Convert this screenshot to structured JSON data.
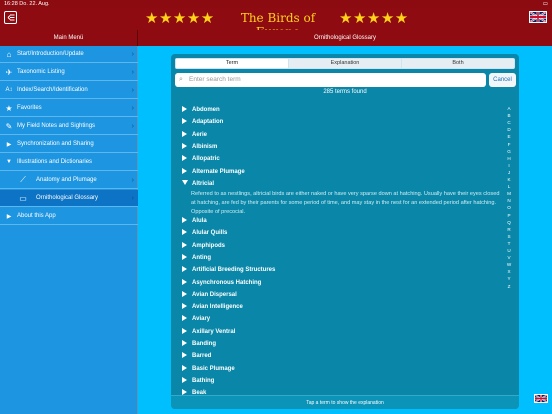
{
  "status_bar": {
    "time": "16:28",
    "date": "Do. 22. Aug."
  },
  "app": {
    "title": "The Birds of Europe",
    "stars": "★★★★★"
  },
  "sidebar": {
    "header": "Main Menü",
    "items": [
      {
        "label": "Start/Introduction/Update",
        "icon": "home-icon",
        "glyph": "⌂"
      },
      {
        "label": "Taxonomic Listing",
        "icon": "bird-icon",
        "glyph": "✈"
      },
      {
        "label": "Index/Search/Identification",
        "icon": "az-index-icon",
        "glyph": "A↕"
      },
      {
        "label": "Favorites",
        "icon": "star-icon",
        "glyph": "★"
      },
      {
        "label": "My Field Notes and Sightings",
        "icon": "notes-icon",
        "glyph": "✎"
      },
      {
        "label": "Synchronization and Sharing",
        "icon": "triangle-right-icon",
        "glyph": "▶"
      },
      {
        "label": "Illustrations and Dictionaries",
        "icon": "triangle-down-icon",
        "glyph": "▼"
      },
      {
        "label": "Anatomy and Plumage",
        "icon": "feather-icon",
        "glyph": "⟋"
      },
      {
        "label": "Ornithological Glossary",
        "icon": "book-icon",
        "glyph": "▭"
      },
      {
        "label": "About this App",
        "icon": "triangle-right-icon",
        "glyph": "▶"
      }
    ]
  },
  "main": {
    "header": "Ornithological Glossary",
    "tabs": [
      {
        "label": "Term",
        "active": true
      },
      {
        "label": "Explanation",
        "active": false
      },
      {
        "label": "Both",
        "active": false
      }
    ],
    "search": {
      "placeholder": "Enter search term",
      "cancel": "Cancel"
    },
    "count": "285 terms found",
    "terms": [
      "Abdomen",
      "Adaptation",
      "Aerie",
      "Albinism",
      "Allopatric",
      "Alternate Plumage",
      "Altricial",
      "Alula",
      "Alular Quills",
      "Amphipods",
      "Anting",
      "Artificial Breeding Structures",
      "Asynchronous Hatching",
      "Avian Dispersal",
      "Avian Intelligence",
      "Aviary",
      "Axillary Ventral",
      "Banding",
      "Barred",
      "Basic Plumage",
      "Bathing",
      "Beak"
    ],
    "expanded_term": "Altricial",
    "explanation": "Referred to as nestlings, altricial birds are either naked or have very sparse down at hatching. Usually have their eyes closed at hatching, are fed by their parents for some period of time, and may stay in the nest for an extended period after hatching. Opposite of precocial.",
    "alphabet": [
      "A",
      "B",
      "C",
      "D",
      "E",
      "F",
      "G",
      "H",
      "I",
      "J",
      "K",
      "L",
      "M",
      "N",
      "O",
      "P",
      "Q",
      "R",
      "S",
      "T",
      "U",
      "V",
      "W",
      "X",
      "Y",
      "Z"
    ],
    "footer": "Tap a term to show the explanation"
  },
  "colors": {
    "titlebar": "#8e0b12",
    "background": "#00bfff",
    "sidebar": "#1e95e0",
    "panel": "#0a87a8",
    "stars": "#ffd21a"
  }
}
